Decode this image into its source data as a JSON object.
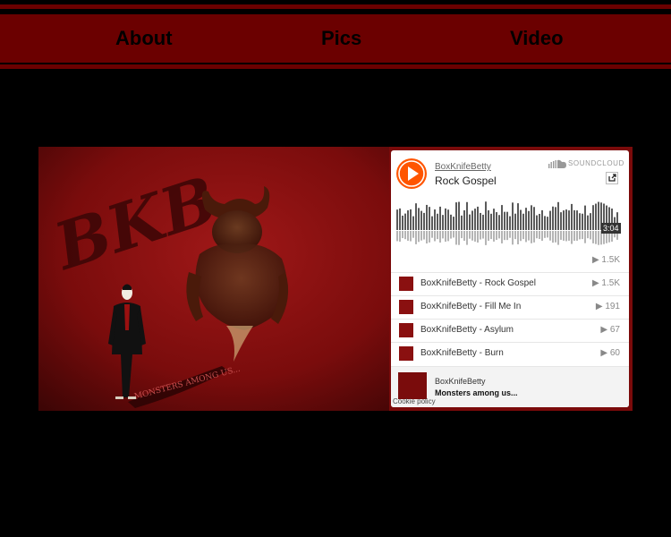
{
  "nav": {
    "items": [
      "About",
      "Pics",
      "Video"
    ]
  },
  "album_art": {
    "letters": "BKB",
    "caption": "MONSTERS AMONG US..."
  },
  "player": {
    "artist": "BoxKnifeBetty",
    "track_title": "Rock Gospel",
    "brand": "SOUNDCLOUD",
    "duration": "3:04",
    "plays": "1.5K",
    "accent_color": "#ff5500",
    "tracks": [
      {
        "title": "BoxKnifeBetty - Rock Gospel",
        "plays": "1.5K"
      },
      {
        "title": "BoxKnifeBetty - Fill Me In",
        "plays": "191"
      },
      {
        "title": "BoxKnifeBetty - Asylum",
        "plays": "67"
      },
      {
        "title": "BoxKnifeBetty - Burn",
        "plays": "60"
      }
    ],
    "footer": {
      "user": "BoxKnifeBetty",
      "playlist": "Monsters among us..."
    },
    "cookie": "Cookie policy"
  }
}
